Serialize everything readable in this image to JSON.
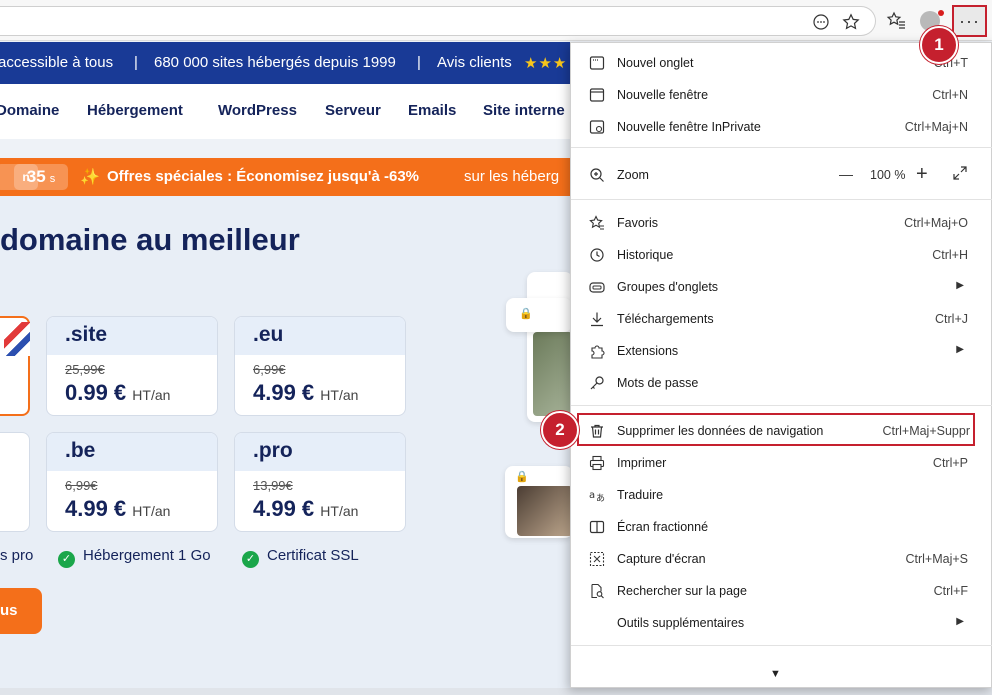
{
  "browser": {
    "more_label": "···"
  },
  "page": {
    "topband": {
      "item1": "accessible à tous",
      "sep1": "|",
      "item2": "680 000 sites hébergés depuis 1999",
      "sep2": "|",
      "item3": "Avis clients",
      "stars": "★★★"
    },
    "nav": [
      "Domaine",
      "Hébergement",
      "WordPress",
      "Serveur",
      "Emails",
      "Site interne"
    ],
    "promo": {
      "timer_unit_prev": "n",
      "timer_value": "35",
      "timer_unit": "s",
      "headline": "Offres spéciales : Économisez jusqu'à -63%",
      "rest": "sur les héberg"
    },
    "hero_title": "domaine au meilleur",
    "domains": [
      {
        "ext": ".site",
        "old": "25,99€",
        "price": "0.99 €",
        "unit": "HT/an"
      },
      {
        "ext": ".eu",
        "old": "6,99€",
        "price": "4.99 €",
        "unit": "HT/an"
      },
      {
        "ext": ".be",
        "old": "6,99€",
        "price": "4.99 €",
        "unit": "HT/an"
      },
      {
        "ext": ".pro",
        "old": "13,99€",
        "price": "4.99 €",
        "unit": "HT/an"
      }
    ],
    "features": [
      "s pro",
      "Hébergement 1 Go",
      "Certificat SSL"
    ],
    "cta": "us",
    "deco_text": "$%"
  },
  "menu": {
    "items": [
      {
        "label": "Nouvel onglet",
        "shortcut": "Ctrl+T"
      },
      {
        "label": "Nouvelle fenêtre",
        "shortcut": "Ctrl+N"
      },
      {
        "label": "Nouvelle fenêtre InPrivate",
        "shortcut": "Ctrl+Maj+N"
      },
      {
        "label": "Zoom",
        "value": "100 %",
        "minus": "—",
        "plus": "+"
      },
      {
        "label": "Favoris",
        "shortcut": "Ctrl+Maj+O"
      },
      {
        "label": "Historique",
        "shortcut": "Ctrl+H"
      },
      {
        "label": "Groupes d'onglets",
        "arrow": "▶"
      },
      {
        "label": "Téléchargements",
        "shortcut": "Ctrl+J"
      },
      {
        "label": "Extensions",
        "arrow": "▶"
      },
      {
        "label": "Mots de passe"
      },
      {
        "label": "Supprimer les données de navigation",
        "shortcut": "Ctrl+Maj+Suppr"
      },
      {
        "label": "Imprimer",
        "shortcut": "Ctrl+P"
      },
      {
        "label": "Traduire"
      },
      {
        "label": "Écran fractionné"
      },
      {
        "label": "Capture d'écran",
        "shortcut": "Ctrl+Maj+S"
      },
      {
        "label": "Rechercher sur la page",
        "shortcut": "Ctrl+F"
      },
      {
        "label": "Outils supplémentaires",
        "arrow": "▶"
      }
    ],
    "scroll_arrow": "▼"
  },
  "annotations": {
    "step1": "1",
    "step2": "2"
  },
  "colors": {
    "accent_red": "#c5202e",
    "brand_blue": "#193a96",
    "promo_orange": "#f46f1a"
  }
}
